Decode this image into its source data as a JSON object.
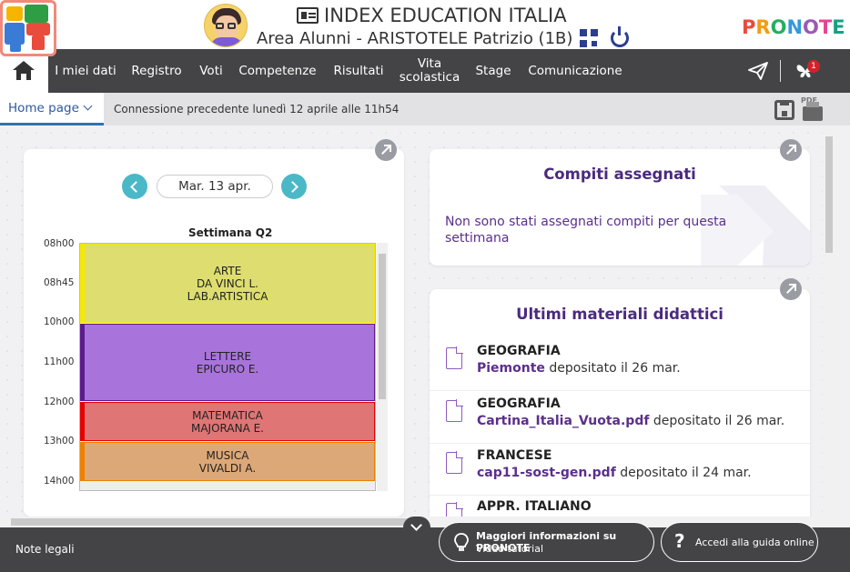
{
  "header": {
    "school": "INDEX EDUCATION ITALIA",
    "student": "Area Alunni - ARISTOTELE Patrizio (1B)",
    "brand": "PRONOTE",
    "brand_colors": [
      "#e74c3c",
      "#f39c12",
      "#27ae60",
      "#3498db",
      "#9b59b6",
      "#e84393",
      "#16a085"
    ]
  },
  "nav": {
    "items": [
      "I miei dati",
      "Registro",
      "Voti",
      "Competenze",
      "Risultati",
      "Vita scolastica",
      "Stage",
      "Comunicazione"
    ],
    "notifications": "1"
  },
  "subbar": {
    "home_tab": "Home page",
    "last_connection": "Connessione precedente lunedì 12 aprile alle 11h54",
    "pdf": "PDF"
  },
  "timetable": {
    "date": "Mar. 13 apr.",
    "week": "Settimana Q2",
    "hours": [
      "08h00",
      "08h45",
      "10h00",
      "11h00",
      "12h00",
      "13h00",
      "14h00"
    ],
    "lessons": [
      {
        "lines": [
          "ARTE",
          "DA VINCI L.",
          "LAB.ARTISTICA"
        ],
        "color": "#dede70",
        "bar": "#f6e800"
      },
      {
        "lines": [
          "LETTERE",
          "EPICURO E."
        ],
        "color": "#a874dc",
        "bar": "#5c1a8f"
      },
      {
        "lines": [
          "MATEMATICA",
          "MAJORANA E."
        ],
        "color": "#e07575",
        "bar": "#e60000"
      },
      {
        "lines": [
          "MUSICA",
          "VIVALDI A."
        ],
        "color": "#dda877",
        "bar": "#f07f00"
      }
    ]
  },
  "homework": {
    "title": "Compiti assegnati",
    "empty": "Non sono stati assegnati compiti per questa settimana"
  },
  "materials": {
    "title": "Ultimi materiali didattici",
    "items": [
      {
        "subject": "GEOGRAFIA",
        "file": "Piemonte",
        "text": " depositato il 26 mar."
      },
      {
        "subject": "GEOGRAFIA",
        "file": "Cartina_Italia_Vuota.pdf",
        "text": " depositato il 26 mar."
      },
      {
        "subject": "FRANCESE",
        "file": "cap11-sost-gen.pdf",
        "text": " depositato il 24 mar."
      },
      {
        "subject": "APPR. ITALIANO",
        "file": "",
        "text": ""
      }
    ]
  },
  "footer": {
    "legal": "Note legali",
    "info_title": "Maggiori informazioni su PRONOTE",
    "info_sub": "Video tutorial",
    "guide": "Accedi alla guida online"
  }
}
